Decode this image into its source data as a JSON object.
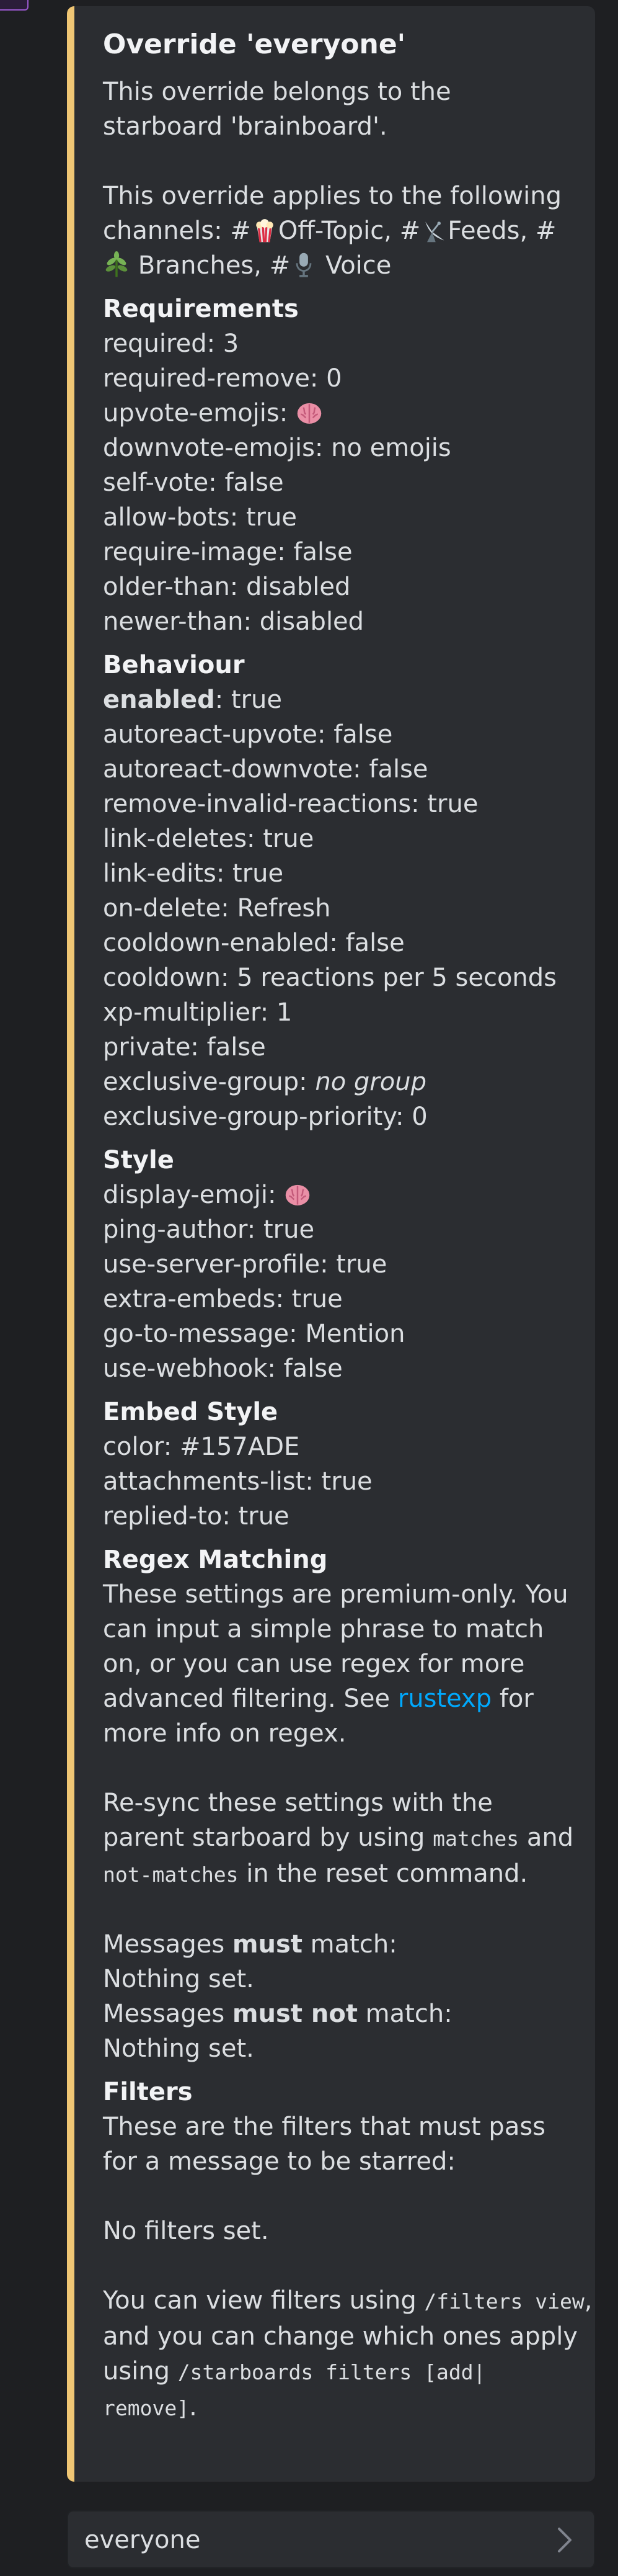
{
  "embed": {
    "accent_color": "#f0c674",
    "title": "Override 'everyone'",
    "intro": "This override belongs to the starboard 'brainboard'.",
    "channels_prefix": "This override applies to the following channels:",
    "channels": [
      {
        "name": "Off-Topic",
        "icon": "popcorn-icon"
      },
      {
        "name": "Feeds",
        "icon": "satellite-dish-icon"
      },
      {
        "name": "Branches",
        "icon": "herb-icon"
      },
      {
        "name": "Voice",
        "icon": "microphone-icon"
      }
    ],
    "requirements": {
      "heading": "Requirements",
      "required": "required: 3",
      "required_remove": "required-remove: 0",
      "upvote_emojis_label": "upvote-emojis:",
      "downvote_emojis": "downvote-emojis: no emojis",
      "self_vote": "self-vote: false",
      "allow_bots": "allow-bots: true",
      "require_image": "require-image: false",
      "older_than": "older-than: disabled",
      "newer_than": "newer-than: disabled"
    },
    "behaviour": {
      "heading": "Behaviour",
      "enabled_key": "enabled",
      "enabled_val": ": true",
      "autoreact_upvote": "autoreact-upvote: false",
      "autoreact_downvote": "autoreact-downvote: false",
      "remove_invalid": "remove-invalid-reactions: true",
      "link_deletes": "link-deletes: true",
      "link_edits": "link-edits: true",
      "on_delete": "on-delete: Refresh",
      "cooldown_enabled": "cooldown-enabled: false",
      "cooldown": "cooldown: 5 reactions per 5 seconds",
      "xp_multiplier": "xp-multiplier: 1",
      "private": "private: false",
      "exclusive_group_key": "exclusive-group: ",
      "exclusive_group_val": "no group",
      "exclusive_group_priority": "exclusive-group-priority: 0"
    },
    "style": {
      "heading": "Style",
      "display_emoji_label": "display-emoji:",
      "ping_author": "ping-author: true",
      "use_server_profile": "use-server-profile: true",
      "extra_embeds": "extra-embeds: true",
      "go_to_message": "go-to-message: Mention",
      "use_webhook": "use-webhook: false"
    },
    "embed_style": {
      "heading": "Embed Style",
      "color": "color: #157ADE",
      "attachments_list": "attachments-list: true",
      "replied_to": "replied-to: true"
    },
    "regex": {
      "heading": "Regex Matching",
      "text1": "These settings are premium-only. You can input a simple phrase to match on, or you can use regex for more advanced filtering. See ",
      "link": "rustexp",
      "text2": " for more info on regex.",
      "resync_a": "Re-sync these settings with the",
      "resync_b": "parent starboard by using ",
      "code_matches": "matches",
      "and": " and",
      "code_not_matches": "not-matches",
      "resync_c": " in the reset command.",
      "must_prefix": "Messages ",
      "must": "must",
      "match_suffix": " match:",
      "nothing1": "Nothing set.",
      "must_not": "must not",
      "nothing2": "Nothing set."
    },
    "filters": {
      "heading": "Filters",
      "desc": "These are the filters that must pass for a message to be starred:",
      "none": "No filters set.",
      "view_a": "You can view filters using ",
      "view_code": "/filters view",
      "view_b": ",",
      "change_a": "and you can change which ones apply",
      "using": "using ",
      "change_code1": "/starboards filters [add|",
      "change_code2": "remove]",
      "end": "."
    }
  },
  "select_menu": {
    "value": "everyone",
    "icon": "chevron-right-icon"
  }
}
